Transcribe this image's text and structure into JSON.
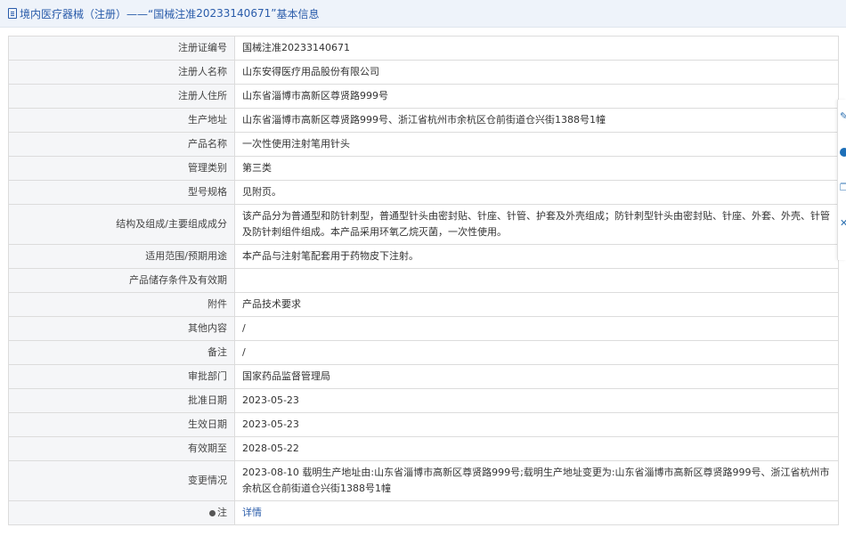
{
  "header": {
    "prefix": "境内医疗器械（注册）——",
    "quote_open": "“国械注准",
    "reg_no": "20233140671",
    "quote_close": "”",
    "suffix": "基本信息"
  },
  "rows": [
    {
      "key": "注册证编号",
      "value": "国械注准20233140671"
    },
    {
      "key": "注册人名称",
      "value": "山东安得医疗用品股份有限公司"
    },
    {
      "key": "注册人住所",
      "value": "山东省淄博市高新区尊贤路999号"
    },
    {
      "key": "生产地址",
      "value": "山东省淄博市高新区尊贤路999号、浙江省杭州市余杭区仓前街道仓兴街1388号1幢"
    },
    {
      "key": "产品名称",
      "value": "一次性使用注射笔用针头"
    },
    {
      "key": "管理类别",
      "value": "第三类"
    },
    {
      "key": "型号规格",
      "value": "见附页。"
    },
    {
      "key": "结构及组成/主要组成成分",
      "value": "该产品分为普通型和防针刺型，普通型针头由密封贴、针座、针管、护套及外壳组成；防针刺型针头由密封贴、针座、外套、外壳、针管及防针刺组件组成。本产品采用环氧乙烷灭菌，一次性使用。"
    },
    {
      "key": "适用范围/预期用途",
      "value": "本产品与注射笔配套用于药物皮下注射。"
    },
    {
      "key": "产品储存条件及有效期",
      "value": ""
    },
    {
      "key": "附件",
      "value": "产品技术要求"
    },
    {
      "key": "其他内容",
      "value": "/"
    },
    {
      "key": "备注",
      "value": "/"
    },
    {
      "key": "审批部门",
      "value": "国家药品监督管理局"
    },
    {
      "key": "批准日期",
      "value": "2023-05-23"
    },
    {
      "key": "生效日期",
      "value": "2023-05-23"
    },
    {
      "key": "有效期至",
      "value": "2028-05-22"
    },
    {
      "key": "变更情况",
      "value": "2023-08-10 载明生产地址由:山东省淄博市高新区尊贤路999号;载明生产地址变更为:山东省淄博市高新区尊贤路999号、浙江省杭州市余杭区仓前街道仓兴街1388号1幢"
    }
  ],
  "note": {
    "key": "注",
    "link": "详情"
  },
  "side_tools": [
    "edit-icon",
    "help-icon",
    "copy-icon",
    "close-icon"
  ]
}
